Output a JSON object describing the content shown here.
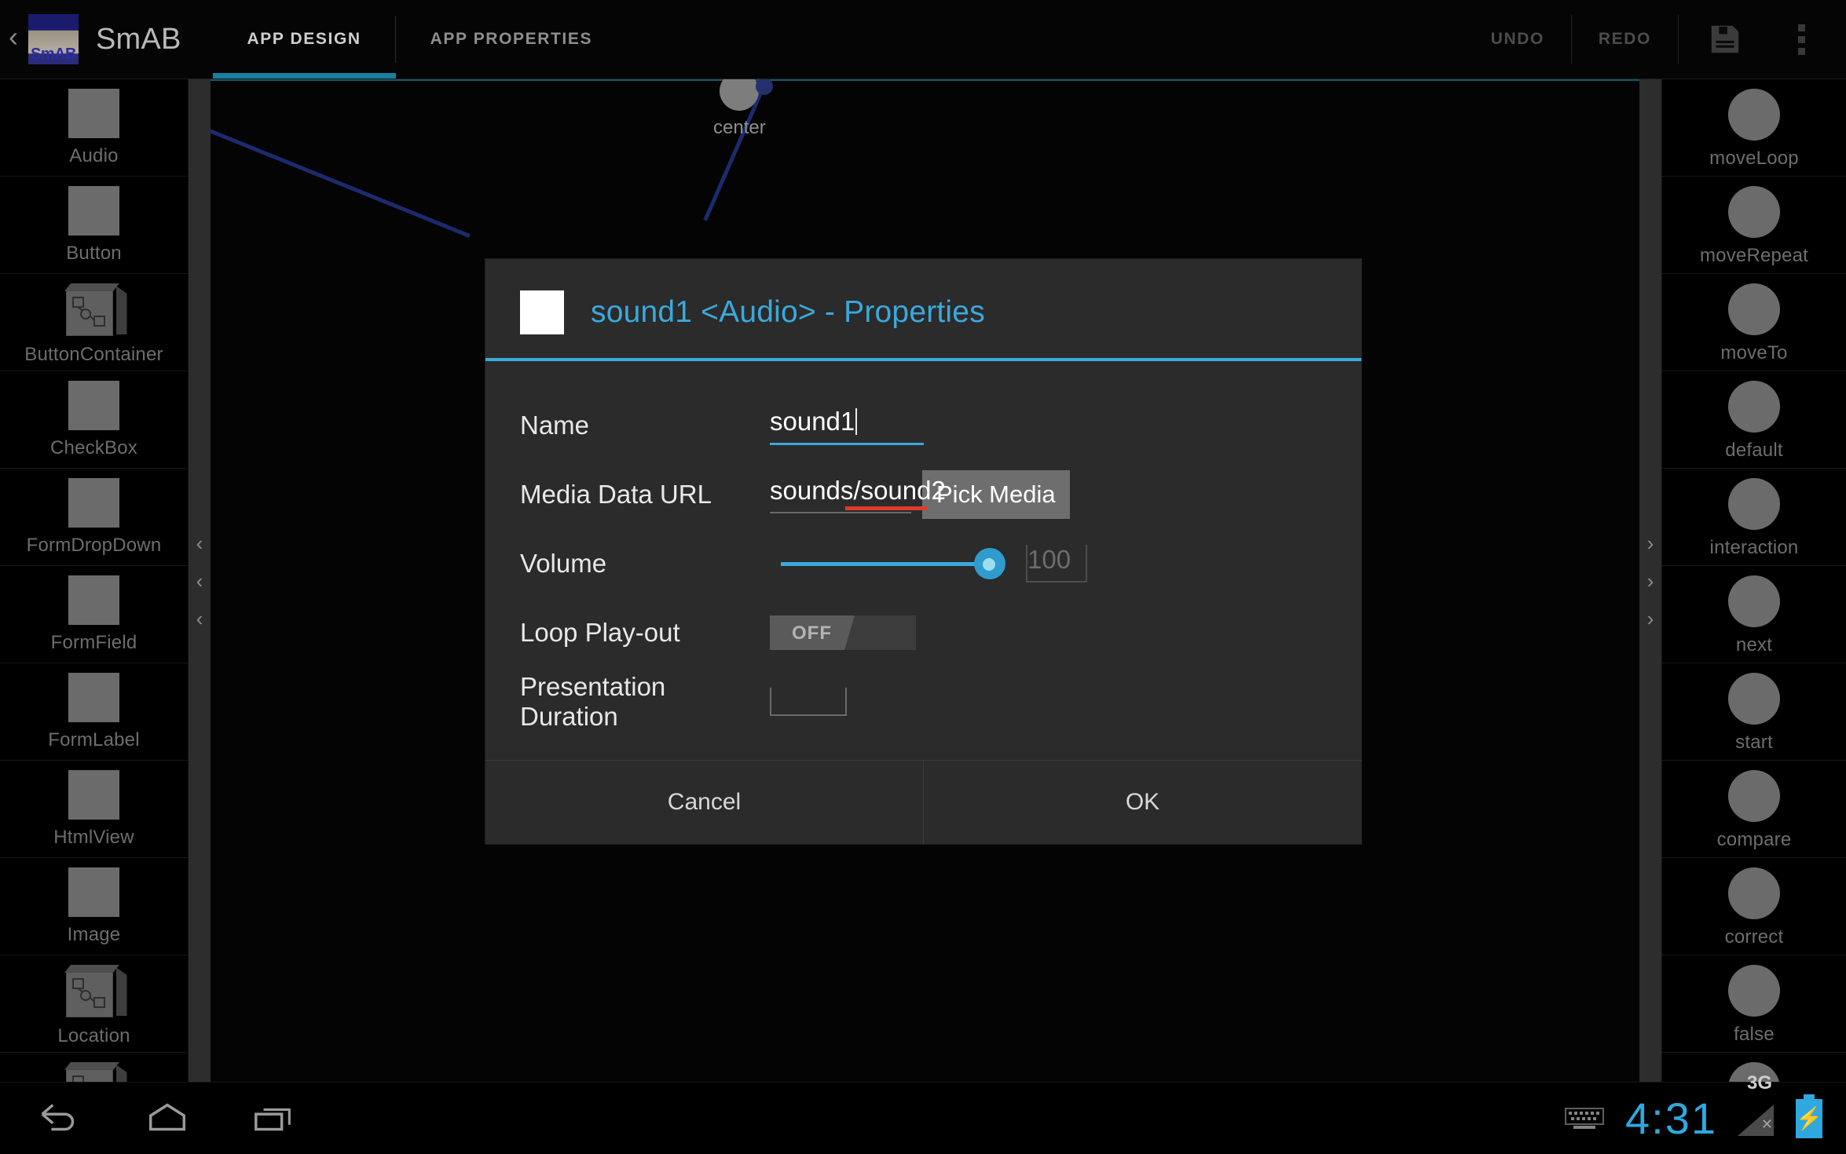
{
  "topbar": {
    "up_icon": "back-chevron-icon",
    "logo_text": "SmAB",
    "app_name": "SmAB",
    "tabs": [
      {
        "label": "APP DESIGN",
        "active": true
      },
      {
        "label": "APP PROPERTIES",
        "active": false
      }
    ],
    "undo_label": "UNDO",
    "redo_label": "REDO",
    "save_icon": "floppy-save-icon",
    "overflow_icon": "kebab-menu-icon"
  },
  "left_palette": {
    "items": [
      {
        "label": "Audio",
        "icon": "square-thumb-icon"
      },
      {
        "label": "Button",
        "icon": "square-thumb-icon"
      },
      {
        "label": "ButtonContainer",
        "icon": "cube-container-icon"
      },
      {
        "label": "CheckBox",
        "icon": "square-thumb-icon"
      },
      {
        "label": "FormDropDown",
        "icon": "square-thumb-icon"
      },
      {
        "label": "FormField",
        "icon": "square-thumb-icon"
      },
      {
        "label": "FormLabel",
        "icon": "square-thumb-icon"
      },
      {
        "label": "HtmlView",
        "icon": "square-thumb-icon"
      },
      {
        "label": "Image",
        "icon": "square-thumb-icon"
      },
      {
        "label": "Location",
        "icon": "cube-container-icon"
      },
      {
        "label": "",
        "icon": "cube-container-icon"
      }
    ],
    "collapse_chevrons": [
      "‹",
      "‹",
      "‹"
    ]
  },
  "right_palette": {
    "items": [
      {
        "label": "moveLoop",
        "icon": "circle-node-icon"
      },
      {
        "label": "moveRepeat",
        "icon": "circle-node-icon"
      },
      {
        "label": "moveTo",
        "icon": "circle-node-icon"
      },
      {
        "label": "default",
        "icon": "circle-node-icon"
      },
      {
        "label": "interaction",
        "icon": "circle-node-icon"
      },
      {
        "label": "next",
        "icon": "circle-node-icon"
      },
      {
        "label": "start",
        "icon": "circle-node-icon"
      },
      {
        "label": "compare",
        "icon": "circle-node-icon"
      },
      {
        "label": "correct",
        "icon": "circle-node-icon"
      },
      {
        "label": "false",
        "icon": "circle-node-icon"
      },
      {
        "label": "",
        "icon": "circle-node-icon"
      }
    ],
    "collapse_chevrons": [
      "›",
      "›",
      "›"
    ]
  },
  "canvas": {
    "node_label": "center",
    "wire_color": "#1c2a6e"
  },
  "dialog": {
    "title": "sound1 <Audio> - Properties",
    "swatch_color": "#ffffff",
    "accent_color": "#3aa9dd",
    "fields": [
      {
        "label": "Name",
        "value": "sound1",
        "type": "text-focused"
      },
      {
        "label": "Media Data URL",
        "value": "sounds/sound2",
        "type": "text-spellcheck",
        "button": "Pick Media"
      },
      {
        "label": "Volume",
        "value": "100",
        "type": "slider",
        "slider_percent": 100
      },
      {
        "label": "Loop Play-out",
        "value": "OFF",
        "type": "toggle",
        "on": false
      },
      {
        "label": "Presentation Duration",
        "value": "",
        "type": "text-empty"
      }
    ],
    "buttons": {
      "cancel": "Cancel",
      "ok": "OK"
    }
  },
  "navbar": {
    "back_icon": "back-arrow-icon",
    "home_icon": "home-icon",
    "recents_icon": "recent-apps-icon",
    "keyboard_icon": "keyboard-icon",
    "clock": "4:31",
    "network": "3G",
    "network_state_icon": "no-data-x-icon",
    "battery_icon": "battery-charging-icon",
    "clock_color": "#2fa8e0"
  }
}
